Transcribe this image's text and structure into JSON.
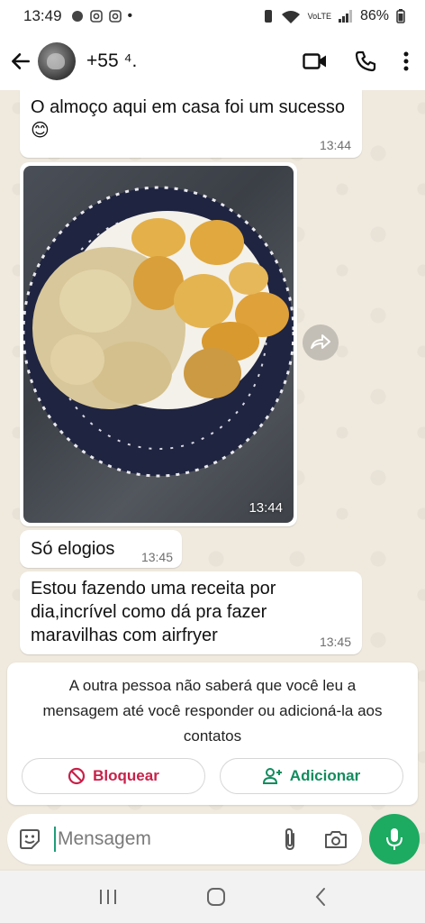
{
  "status_bar": {
    "time": "13:49",
    "battery": "86%",
    "dot": "•",
    "signal_label": "VoLTE"
  },
  "header": {
    "contact": "+55 ⁴."
  },
  "messages": [
    {
      "text": "O almoço aqui em casa foi um sucesso😊",
      "time": "13:44"
    },
    {
      "type": "image",
      "time": "13:44",
      "description_icon": "food-photo"
    },
    {
      "text": "Só elogios",
      "time": "13:45"
    },
    {
      "text": "Estou fazendo uma receita por dia,incrível como dá pra fazer maravilhas com airfryer",
      "time": "13:45"
    }
  ],
  "notice": {
    "text": "A outra pessoa não saberá que você leu a mensagem até você responder ou adicioná-la aos contatos",
    "block_label": "Bloquear",
    "add_label": "Adicionar"
  },
  "input": {
    "placeholder": "Mensagem"
  },
  "colors": {
    "accent": "#1daa61",
    "block": "#c8214a",
    "add": "#128c5e"
  }
}
